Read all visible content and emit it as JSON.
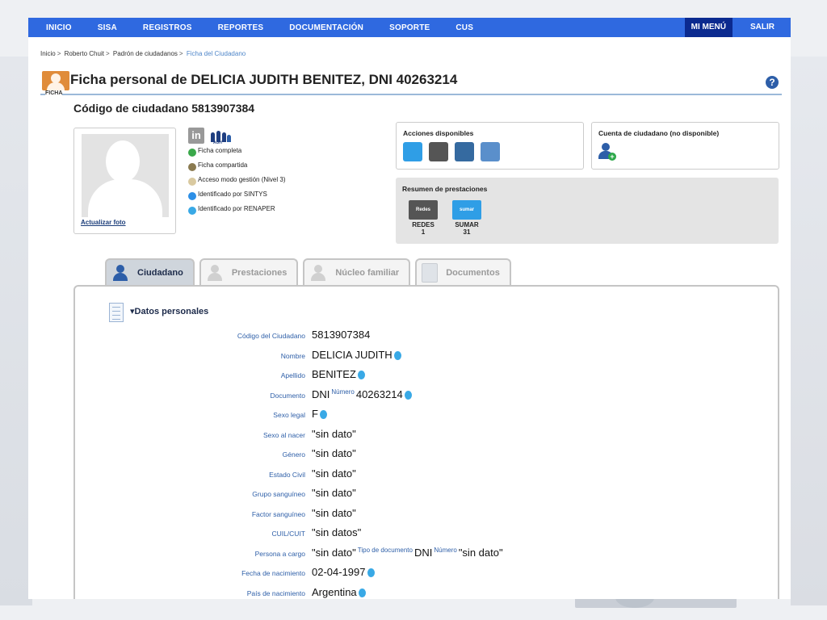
{
  "nav": {
    "items": [
      "INICIO",
      "SISA",
      "REGISTROS",
      "REPORTES",
      "DOCUMENTACIÓN",
      "SOPORTE",
      "CUS"
    ],
    "mi_menu": "MI MENÚ",
    "salir": "SALIR"
  },
  "breadcrumb": [
    "Inicio",
    "Roberto Chuit",
    "Padrón de ciudadanos",
    "Ficha del Ciudadano"
  ],
  "header": {
    "ficha_label": "FICHA",
    "title": "Ficha personal de DELICIA JUDITH BENITEZ, DNI 40263214",
    "citizen_code": "Código de ciudadano 5813907384"
  },
  "photo": {
    "update_link": "Actualizar foto"
  },
  "status": {
    "auh_badge": "AUH",
    "items": [
      {
        "label": "Ficha completa",
        "color": "#3aa84a"
      },
      {
        "label": "Ficha compartida",
        "color": "#8a7a50"
      },
      {
        "label": "Acceso modo gestión (Nivel 3)",
        "color": "#d9c9a0"
      },
      {
        "label": "Identificado por SINTYS",
        "color": "#2d8fe6"
      },
      {
        "label": "Identificado por RENAPER",
        "color": "#39a9e6"
      }
    ]
  },
  "actions": {
    "title": "Acciones disponibles",
    "icons": [
      "cd-icon",
      "printer-icon",
      "scanner-icon",
      "card-icon"
    ],
    "colors": [
      "#2f9ee6",
      "#555555",
      "#356aa0",
      "#5a8fcb"
    ]
  },
  "account": {
    "title": "Cuenta de ciudadano (no disponible)"
  },
  "summary": {
    "title": "Resumen de prestaciones",
    "programs": [
      {
        "name": "REDES",
        "count": "1",
        "logo_text": "Redes",
        "color": "#555555"
      },
      {
        "name": "SUMAR",
        "count": "31",
        "logo_text": "sumar",
        "color": "#2f9ee6"
      }
    ]
  },
  "tabs": [
    {
      "label": "Ciudadano",
      "active": true
    },
    {
      "label": "Prestaciones",
      "active": false
    },
    {
      "label": "Núcleo familiar",
      "active": false
    },
    {
      "label": "Documentos",
      "active": false
    }
  ],
  "section": {
    "title": "Datos personales",
    "fields": [
      {
        "label": "Código del Ciudadano",
        "value": "5813907384"
      },
      {
        "label": "Nombre",
        "value": "DELICIA JUDITH"
      },
      {
        "label": "Apellido",
        "value": "BENITEZ"
      },
      {
        "label": "Documento",
        "value": "DNI",
        "sup": "Número",
        "value2": "40263214"
      },
      {
        "label": "Sexo legal",
        "value": "F"
      },
      {
        "label": "Sexo al nacer",
        "value": "\"sin dato\""
      },
      {
        "label": "Género",
        "value": "\"sin dato\""
      },
      {
        "label": "Estado Civil",
        "value": "\"sin dato\""
      },
      {
        "label": "Grupo sanguíneo",
        "value": "\"sin dato\""
      },
      {
        "label": "Factor sanguíneo",
        "value": "\"sin dato\""
      },
      {
        "label": "CUIL/CUIT",
        "value": "\"sin datos\""
      },
      {
        "label": "Persona a cargo",
        "value": "\"sin dato\"",
        "sup": "Tipo de documento",
        "value2": "DNI",
        "sup2": "Número",
        "value3": "\"sin dato\""
      },
      {
        "label": "Fecha de nacimiento",
        "value": "02-04-1997"
      },
      {
        "label": "País de nacimiento",
        "value": "Argentina"
      }
    ]
  }
}
